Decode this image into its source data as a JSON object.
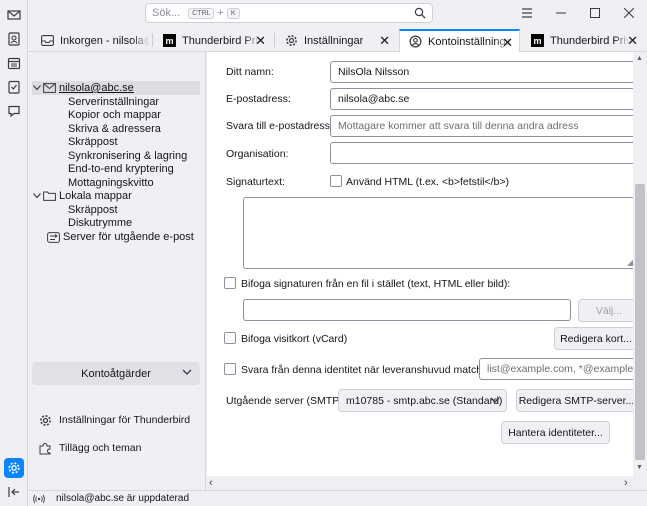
{
  "titlebar": {
    "search_placeholder": "Sök...",
    "shortcut_key1": "CTRL",
    "shortcut_plus": "+",
    "shortcut_key2": "K"
  },
  "tabs": [
    {
      "label": "Inkorgen - nilsola@abc.se",
      "icon": "inbox-icon"
    },
    {
      "label": "Thunderbird Privacy",
      "icon": "mozilla-m-icon"
    },
    {
      "label": "Inställningar",
      "icon": "gear-icon"
    },
    {
      "label": "Kontoinställningar",
      "icon": "account-settings-icon",
      "selected": true
    },
    {
      "label": "Thunderbird Privacy",
      "icon": "mozilla-m-icon"
    }
  ],
  "tree": {
    "account": "nilsola@abc.se",
    "account_items": [
      "Serverinställningar",
      "Kopior och mappar",
      "Skriva & adressera",
      "Skräppost",
      "Synkronisering & lagring",
      "End-to-end kryptering",
      "Mottagningskvitto"
    ],
    "local_folders": "Lokala mappar",
    "local_items": [
      "Skräppost",
      "Diskutrymme"
    ],
    "outgoing_server": "Server för utgående e-post",
    "account_actions": "Kontoåtgärder",
    "settings_link": "Inställningar för Thunderbird",
    "addons_link": "Tillägg och teman"
  },
  "form": {
    "name_label": "Ditt namn:",
    "name_value": "NilsOla Nilsson",
    "email_label": "E-postadress:",
    "email_value": "nilsola@abc.se",
    "reply_label": "Svara till e-postadress:",
    "reply_placeholder": "Mottagare kommer att svara till denna andra adress",
    "org_label": "Organisation:",
    "org_value": "",
    "sig_label": "Signaturtext:",
    "use_html_label": "Använd HTML (t.ex. <b>fetstil</b>)",
    "attach_sig_label": "Bifoga signaturen från en fil i stället (text, HTML eller bild):",
    "choose_button": "Välj...",
    "vcard_label": "Bifoga visitkort (vCard)",
    "edit_card_button": "Redigera kort...",
    "reply_identity_label": "Svara från denna identitet när leveranshuvud matchar:",
    "reply_identity_placeholder": "list@example.com, *@example.com",
    "smtp_label": "Utgående server (SMTP):",
    "smtp_value": "m10785 - smtp.abc.se (Standard)",
    "edit_smtp_button": "Redigera SMTP-server...",
    "manage_identities_button": "Hantera identiteter..."
  },
  "status": {
    "text": "nilsola@abc.se är uppdaterad"
  },
  "colors": {
    "accent": "#0a84ff",
    "chrome_bg": "#f0f0f4",
    "content_bg": "#ffffff"
  }
}
